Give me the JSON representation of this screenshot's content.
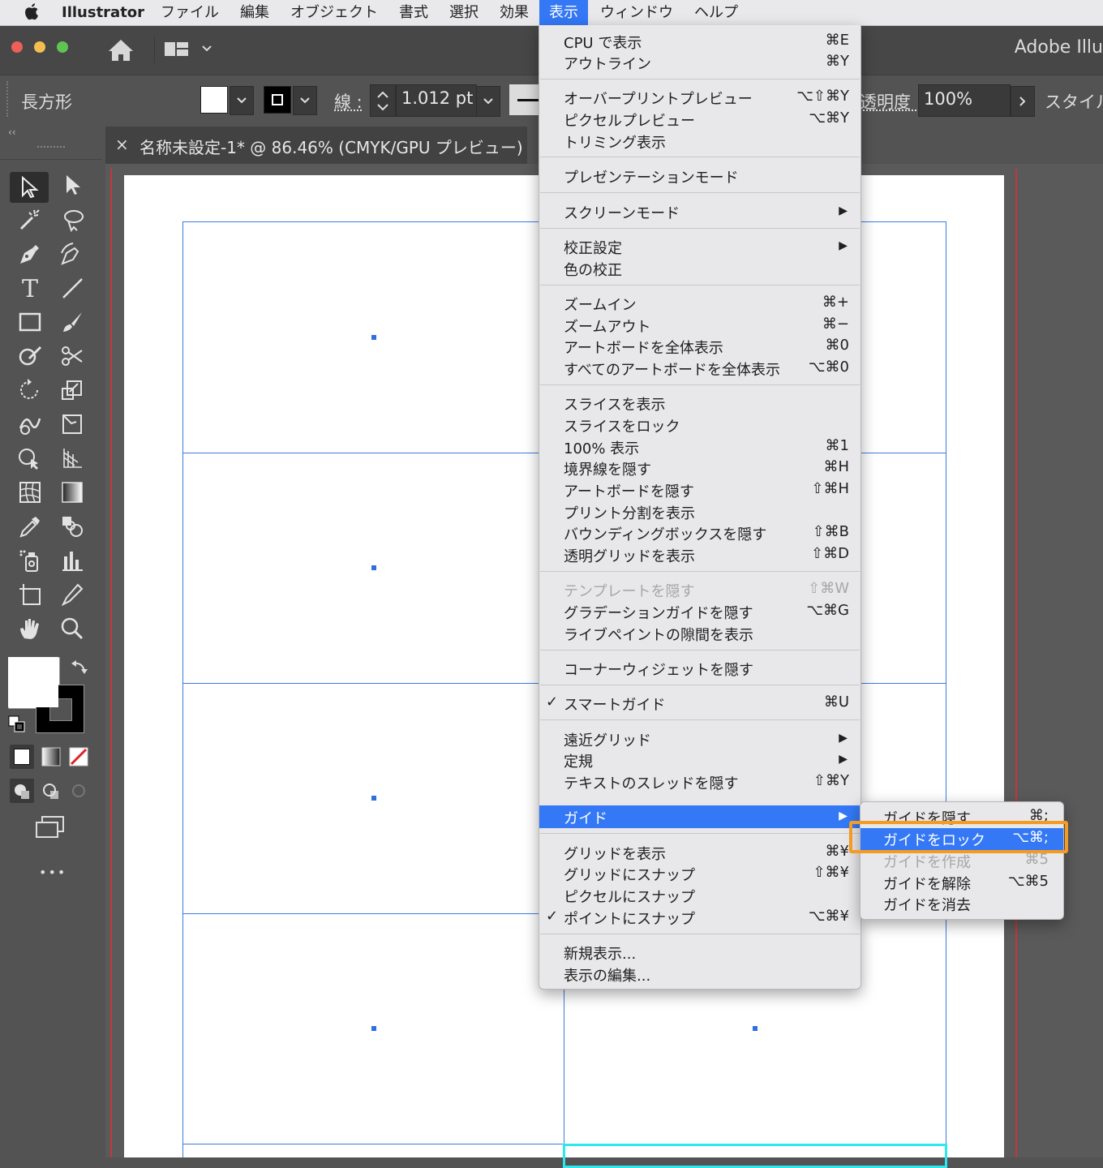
{
  "menubar": {
    "apple_icon": "apple-icon",
    "app_name": "Illustrator",
    "items": [
      "ファイル",
      "編集",
      "オブジェクト",
      "書式",
      "選択",
      "効果",
      "表示",
      "ウィンドウ",
      "ヘルプ"
    ]
  },
  "titlebar": {
    "app_title": "Adobe Illu"
  },
  "controlbar": {
    "object_type": "長方形",
    "stroke_label": "線 :",
    "stroke_value": "1.012 pt",
    "opacity_label": "透明度 :",
    "opacity_value": "100%",
    "style_label": "スタイル"
  },
  "document": {
    "tab_title": "名称未設定-1* @ 86.46% (CMYK/GPU プレビュー)",
    "close_glyph": "×"
  },
  "toolbar": {
    "collapse_glyph": "‹‹",
    "more_glyph": "•••"
  },
  "view_menu": {
    "cpu": "CPU で表示",
    "cpu_sc": "⌘E",
    "outline": "アウトライン",
    "outline_sc": "⌘Y",
    "overprint": "オーバープリントプレビュー",
    "overprint_sc": "⌥⇧⌘Y",
    "pixel": "ピクセルプレビュー",
    "pixel_sc": "⌥⌘Y",
    "trim": "トリミング表示",
    "presentation": "プレゼンテーションモード",
    "screenmode": "スクリーンモード",
    "proof_setup": "校正設定",
    "proof_colors": "色の校正",
    "zoom_in": "ズームイン",
    "zoom_in_sc": "⌘+",
    "zoom_out": "ズームアウト",
    "zoom_out_sc": "⌘−",
    "fit_artboard": "アートボードを全体表示",
    "fit_artboard_sc": "⌘0",
    "fit_all": "すべてのアートボードを全体表示",
    "fit_all_sc": "⌥⌘0",
    "show_slices": "スライスを表示",
    "lock_slices": "スライスをロック",
    "actual": "100% 表示",
    "actual_sc": "⌘1",
    "hide_edges": "境界線を隠す",
    "hide_edges_sc": "⌘H",
    "hide_artboards": "アートボードを隠す",
    "hide_artboards_sc": "⇧⌘H",
    "print_tiling": "プリント分割を表示",
    "hide_bbox": "バウンディングボックスを隠す",
    "hide_bbox_sc": "⇧⌘B",
    "transp_grid": "透明グリッドを表示",
    "transp_grid_sc": "⇧⌘D",
    "hide_template": "テンプレートを隠す",
    "hide_template_sc": "⇧⌘W",
    "gradient_guide": "グラデーションガイドを隠す",
    "gradient_guide_sc": "⌥⌘G",
    "live_paint_gaps": "ライブペイントの隙間を表示",
    "corner_widget": "コーナーウィジェットを隠す",
    "check": "✓",
    "smart_guides": "スマートガイド",
    "smart_guides_sc": "⌘U",
    "perspective_grid": "遠近グリッド",
    "rulers": "定規",
    "text_threads": "テキストのスレッドを隠す",
    "text_threads_sc": "⇧⌘Y",
    "guides": "ガイド",
    "show_grid": "グリッドを表示",
    "show_grid_sc": "⌘¥",
    "snap_grid": "グリッドにスナップ",
    "snap_grid_sc": "⇧⌘¥",
    "snap_pixel": "ピクセルにスナップ",
    "snap_point": "ポイントにスナップ",
    "snap_point_sc": "⌥⌘¥",
    "new_view": "新規表示...",
    "edit_views": "表示の編集...",
    "submenu_arrow": "▶"
  },
  "guides_submenu": {
    "hide": "ガイドを隠す",
    "hide_sc": "⌘;",
    "lock": "ガイドをロック",
    "lock_sc": "⌥⌘;",
    "make": "ガイドを作成",
    "make_sc": "⌘5",
    "release": "ガイドを解除",
    "release_sc": "⌥⌘5",
    "clear": "ガイドを消去"
  },
  "colors": {
    "menu_highlight": "#3478f6",
    "callout": "#f39b23",
    "guide": "#3d7be0",
    "bleed": "#c0393b",
    "selection": "#2ee8f0"
  }
}
